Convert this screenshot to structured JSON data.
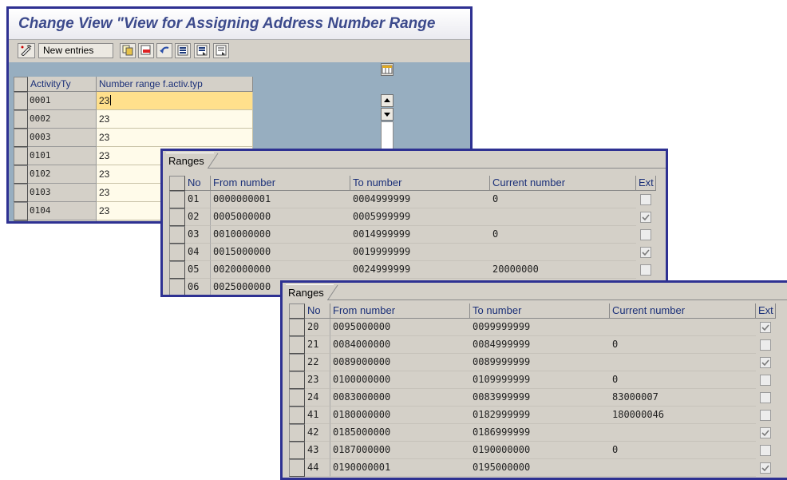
{
  "main_window": {
    "title": "Change View \"View for Assigning Address Number Range",
    "toolbar": {
      "new_entries_label": "New entries",
      "icons": [
        "edit-toggle-icon",
        "copy-icon",
        "delete-icon",
        "undo-icon",
        "select-all-icon",
        "select-block-icon",
        "deselect-all-icon"
      ]
    },
    "table": {
      "columns": [
        "ActivityTy",
        "Number range f.activ.typ"
      ],
      "rows": [
        {
          "activity": "0001",
          "range": "23"
        },
        {
          "activity": "0002",
          "range": "23"
        },
        {
          "activity": "0003",
          "range": "23"
        },
        {
          "activity": "0101",
          "range": "23"
        },
        {
          "activity": "0102",
          "range": "23"
        },
        {
          "activity": "0103",
          "range": "23"
        },
        {
          "activity": "0104",
          "range": "23"
        }
      ]
    }
  },
  "ranges_window_1": {
    "tab": "Ranges",
    "columns": [
      "No",
      "From number",
      "To number",
      "Current number",
      "Ext"
    ],
    "rows": [
      {
        "no": "01",
        "from": "0000000001",
        "to": "0004999999",
        "current": "0",
        "ext": false
      },
      {
        "no": "02",
        "from": "0005000000",
        "to": "0005999999",
        "current": "",
        "ext": true
      },
      {
        "no": "03",
        "from": "0010000000",
        "to": "0014999999",
        "current": "0",
        "ext": false
      },
      {
        "no": "04",
        "from": "0015000000",
        "to": "0019999999",
        "current": "",
        "ext": true
      },
      {
        "no": "05",
        "from": "0020000000",
        "to": "0024999999",
        "current": "20000000",
        "ext": false
      },
      {
        "no": "06",
        "from": "0025000000",
        "to": "",
        "current": "",
        "ext": false
      }
    ]
  },
  "ranges_window_2": {
    "tab": "Ranges",
    "columns": [
      "No",
      "From number",
      "To number",
      "Current number",
      "Ext"
    ],
    "rows": [
      {
        "no": "20",
        "from": "0095000000",
        "to": "0099999999",
        "current": "",
        "ext": true
      },
      {
        "no": "21",
        "from": "0084000000",
        "to": "0084999999",
        "current": "0",
        "ext": false
      },
      {
        "no": "22",
        "from": "0089000000",
        "to": "0089999999",
        "current": "",
        "ext": true
      },
      {
        "no": "23",
        "from": "0100000000",
        "to": "0109999999",
        "current": "0",
        "ext": false
      },
      {
        "no": "24",
        "from": "0083000000",
        "to": "0083999999",
        "current": "83000007",
        "ext": false
      },
      {
        "no": "41",
        "from": "0180000000",
        "to": "0182999999",
        "current": "180000046",
        "ext": false
      },
      {
        "no": "42",
        "from": "0185000000",
        "to": "0186999999",
        "current": "",
        "ext": true
      },
      {
        "no": "43",
        "from": "0187000000",
        "to": "0190000000",
        "current": "0",
        "ext": false
      },
      {
        "no": "44",
        "from": "0190000001",
        "to": "0195000000",
        "current": "",
        "ext": true
      }
    ]
  },
  "colors": {
    "frame": "#2e3192",
    "title_text": "#3c4a8c",
    "header_text": "#1a2f78",
    "table_bg": "#97aec0",
    "input_bg": "#fffbea",
    "active_input_bg": "#ffe08c"
  }
}
